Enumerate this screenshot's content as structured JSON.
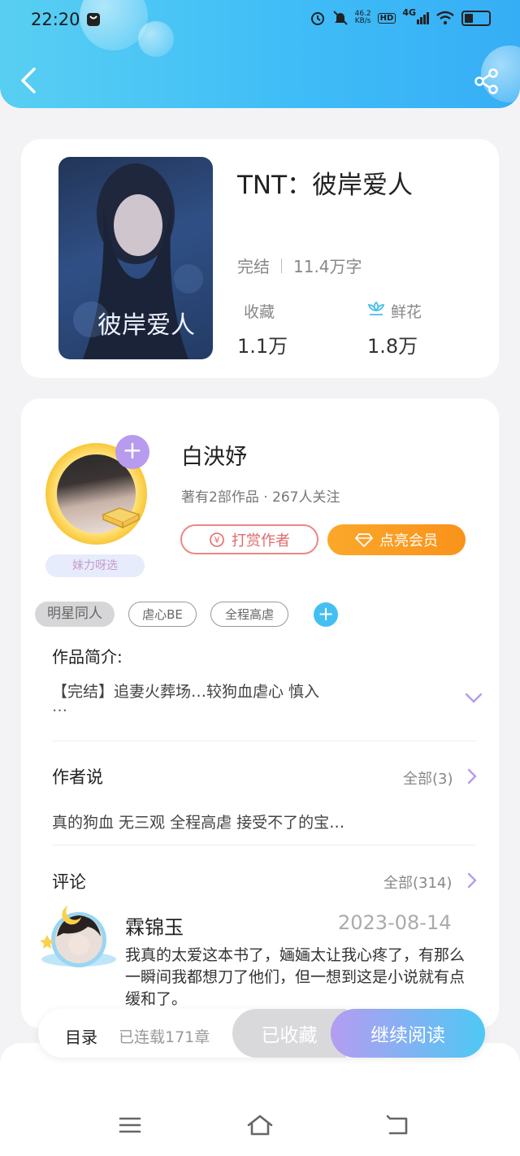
{
  "status_bar": {
    "time": "22:20",
    "net_speed_value": "46.2",
    "net_speed_unit": "KB/s",
    "hd": "HD",
    "signal": "4G"
  },
  "book": {
    "title": "TNT：彼岸爱人",
    "status": "完结",
    "word_count": "11.4万字",
    "favorites_label": "收藏",
    "favorites_value": "1.1万",
    "flowers_label": "鲜花",
    "flowers_value": "1.8万",
    "cover_title": "彼岸爱人"
  },
  "author": {
    "name": "白泱妤",
    "meta": "著有2部作品 · 267人关注",
    "tip_button": "打赏作者",
    "vip_button": "点亮会员",
    "fan_tag": "妹力呀选"
  },
  "tags": [
    "明星同人",
    "虐心BE",
    "全程高虐"
  ],
  "intro": {
    "title": "作品简介:",
    "text": "【完结】追妻火葬场…较狗血虐心 慎入",
    "ellipsis": "…"
  },
  "author_says": {
    "title": "作者说",
    "more": "全部(3)",
    "text": "真的狗血 无三观  全程高虐 接受不了的宝…"
  },
  "comments": {
    "title": "评论",
    "more": "全部(314)",
    "first": {
      "name": "霖锦玉",
      "date": "2023-08-14",
      "text": "我真的太爱这本书了，婳婳太让我心疼了，有那么一瞬间我都想刀了他们，但一想到这是小说就有点缓和了。"
    }
  },
  "action_bar": {
    "toc": "目录",
    "chapters": "已连载171章",
    "favorited": "已收藏",
    "continue": "继续阅读"
  },
  "colors": {
    "header_start": "#58cff2",
    "header_end": "#36aef5",
    "vip_orange": "#f9921a",
    "tip_red": "#e06a6a",
    "accent_purple": "#b69bee"
  }
}
